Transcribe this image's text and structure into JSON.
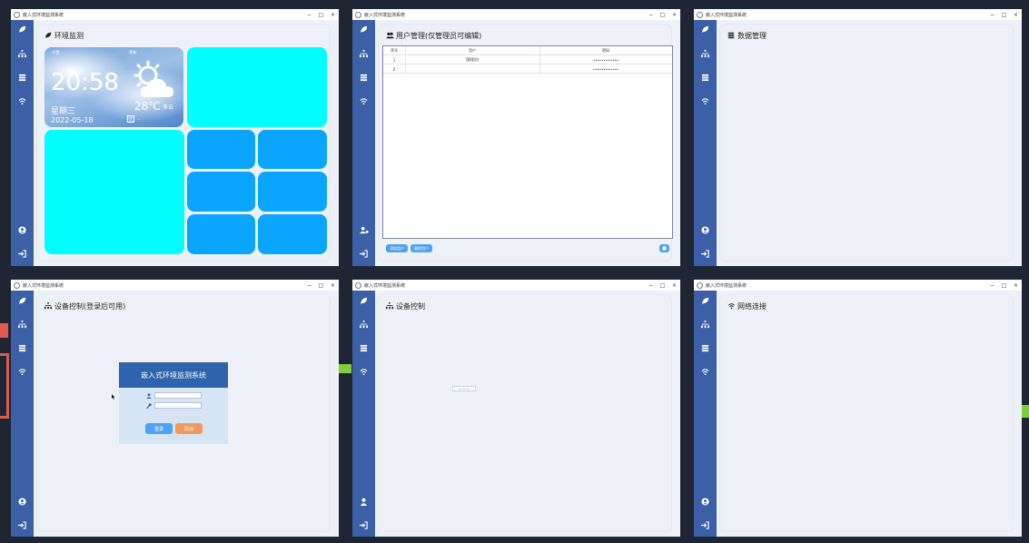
{
  "window_title": "嵌入式环境监测系统",
  "window_controls": {
    "minimize": "−",
    "maximize": "□",
    "close": "×"
  },
  "colors": {
    "sidebar": "#3c60a8",
    "panel": "#eef2f8",
    "cyan_tile": "#00ffff",
    "blue_tile": "#0aa5ff",
    "desktop": "#1f2533"
  },
  "sidebar_icons": [
    "leaf-icon",
    "sitemap-icon",
    "database-icon",
    "wifi-icon",
    "user-circle-icon",
    "logout-icon"
  ],
  "windows": {
    "env_monitor": {
      "title": "环境监测",
      "weather": {
        "location": "·位置·",
        "update": "·更新·",
        "time": "20:58",
        "weekday": "星期三",
        "date": "2022-05-18",
        "temperature": "28℃",
        "condition": "多云",
        "aqi": "优",
        "aqi_detail": "···"
      }
    },
    "user_mgmt": {
      "title": "用户管理(仅管理员可编辑)",
      "columns": [
        "序号",
        "用户",
        "密码"
      ],
      "rows": [
        {
          "index": "1",
          "user": "(管理员)",
          "password": "••••••••••••"
        },
        {
          "index": "2",
          "user": "",
          "password": "••••••••••••"
        }
      ],
      "buttons": {
        "add": "添加用户",
        "delete": "删除用户",
        "save": "保存"
      }
    },
    "data_mgmt": {
      "title": "数据管理"
    },
    "device_ctrl_login": {
      "title": "设备控制(登录后可用)",
      "login": {
        "header": "嵌入式环境监测系统",
        "login_button": "登录",
        "cancel_button": "取消"
      }
    },
    "device_ctrl": {
      "title": "设备控制",
      "center_label": "··········"
    },
    "network": {
      "title": "网络连接"
    }
  }
}
